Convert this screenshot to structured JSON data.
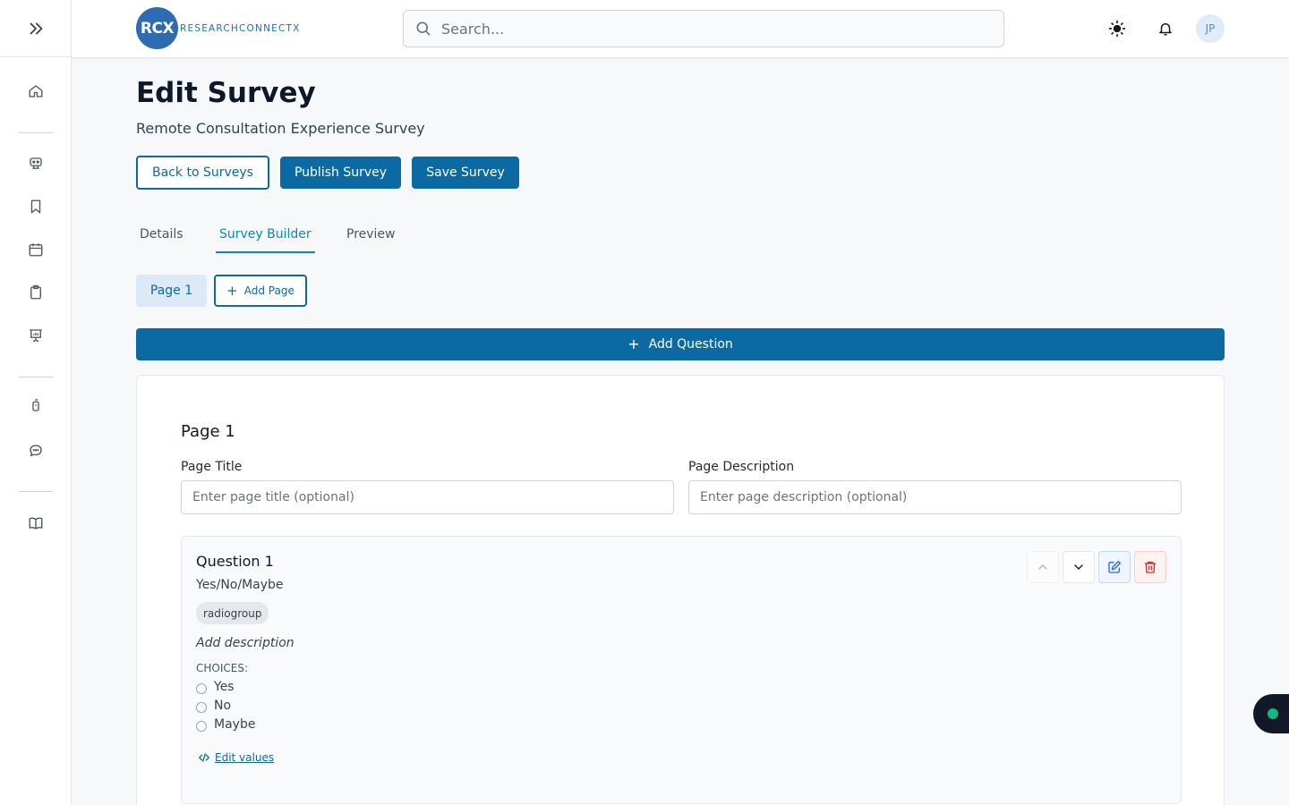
{
  "header": {
    "logo_mark": "RCX",
    "logo_text": "RESEARCHCONNECTX",
    "search_placeholder": "Search...",
    "avatar_initials": "JP"
  },
  "page": {
    "title": "Edit Survey",
    "subtitle": "Remote Consultation Experience Survey"
  },
  "actions": {
    "back": "Back to Surveys",
    "publish": "Publish Survey",
    "save": "Save Survey"
  },
  "tabs": [
    {
      "label": "Details",
      "active": false
    },
    {
      "label": "Survey Builder",
      "active": true
    },
    {
      "label": "Preview",
      "active": false
    }
  ],
  "pages": {
    "current": "Page 1",
    "add_label": "Add Page"
  },
  "add_question_label": "Add Question",
  "page_card": {
    "heading": "Page 1",
    "title_label": "Page Title",
    "title_placeholder": "Enter page title (optional)",
    "desc_label": "Page Description",
    "desc_placeholder": "Enter page description (optional)"
  },
  "question": {
    "title": "Question 1",
    "text": "Yes/No/Maybe",
    "type_badge": "radiogroup",
    "description_placeholder": "Add description",
    "choices_label": "CHOICES:",
    "choices": [
      "Yes",
      "No",
      "Maybe"
    ],
    "edit_values_label": "Edit values"
  },
  "colors": {
    "primary": "#0b6aa2",
    "active_tab": "#0b86c8",
    "status_dot": "#10b981"
  }
}
